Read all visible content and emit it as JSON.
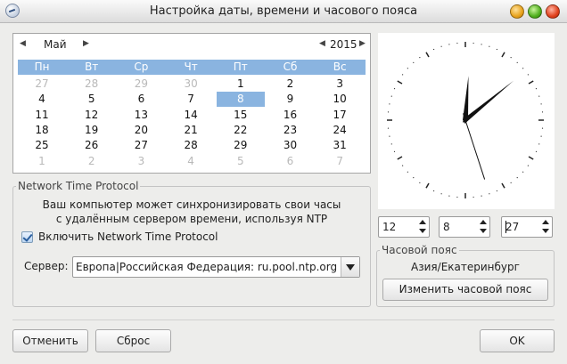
{
  "window": {
    "title": "Настройка даты, времени и часового пояса",
    "icon": "clock-app-icon"
  },
  "calendar": {
    "month": "Май",
    "year": "2015",
    "weekdays": [
      "Пн",
      "Вт",
      "Ср",
      "Чт",
      "Пт",
      "Сб",
      "Вс"
    ],
    "weeks": [
      [
        "27",
        "28",
        "29",
        "30",
        "1",
        "2",
        "3"
      ],
      [
        "4",
        "5",
        "6",
        "7",
        "8",
        "9",
        "10"
      ],
      [
        "11",
        "12",
        "13",
        "14",
        "15",
        "16",
        "17"
      ],
      [
        "18",
        "19",
        "20",
        "21",
        "22",
        "23",
        "24"
      ],
      [
        "25",
        "26",
        "27",
        "28",
        "29",
        "30",
        "31"
      ],
      [
        "1",
        "2",
        "3",
        "4",
        "5",
        "6",
        "7"
      ]
    ],
    "selected_day": "8",
    "selected_color": "#8ab4e0"
  },
  "clock": {
    "hours": 12,
    "minutes": 8,
    "seconds": 27
  },
  "ntp": {
    "group_title": "Network Time Protocol",
    "description_line1": "Ваш компьютер может синхронизировать свои часы",
    "description_line2": "с удалённым сервером времени, используя NTP",
    "enable_label": "Включить Network Time Protocol",
    "enabled": true,
    "server_label": "Сервер:",
    "server_value": "Европа|Российская Федерация: ru.pool.ntp.org"
  },
  "time_inputs": {
    "hours": "12",
    "minutes": "8",
    "seconds": "27"
  },
  "timezone": {
    "group_title": "Часовой пояс",
    "current": "Азия/Екатеринбург",
    "change_button": "Изменить часовой пояс"
  },
  "buttons": {
    "cancel": "Отменить",
    "reset": "Сброс",
    "ok": "OK"
  }
}
